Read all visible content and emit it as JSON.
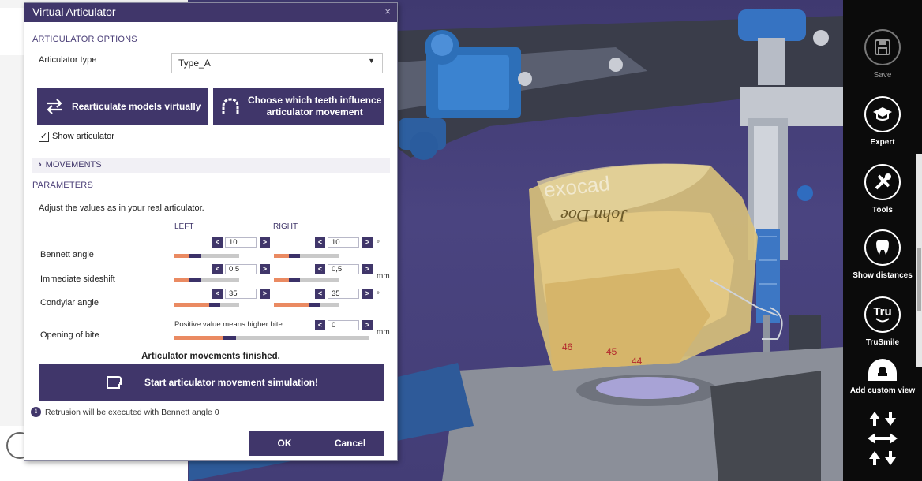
{
  "dialog": {
    "title": "Virtual Articulator",
    "close_glyph": "×",
    "options_heading": "ARTICULATOR OPTIONS",
    "type_label": "Articulator type",
    "type_value": "Type_A",
    "rearticulate_label": "Rearticulate models virtually",
    "teeth_label_line1": "Choose which teeth influence",
    "teeth_label_line2": "articulator movement",
    "show_articulator_label": "Show articulator",
    "show_articulator_checked": true,
    "movements_label": "MOVEMENTS",
    "parameters_heading": "PARAMETERS",
    "parameters_hint": "Adjust the values as in your real articulator.",
    "col_left": "LEFT",
    "col_right": "RIGHT",
    "params": [
      {
        "label": "Bennett angle",
        "left": "10",
        "right": "10",
        "unit": "°",
        "left_level": 0.32,
        "right_level": 0.32
      },
      {
        "label": "Immediate sideshift",
        "left": "0,5",
        "right": "0,5",
        "unit": "mm",
        "left_level": 0.32,
        "right_level": 0.32
      },
      {
        "label": "Condylar angle",
        "left": "35",
        "right": "35",
        "unit": "°",
        "left_level": 0.62,
        "right_level": 0.62
      }
    ],
    "bite": {
      "label": "Opening of bite",
      "note": "Positive value means higher bite",
      "value": "0",
      "unit": "mm",
      "level": 0.31
    },
    "finished_text": "Articulator movements finished.",
    "start_label": "Start articulator movement simulation!",
    "retrusion_note": "Retrusion will be executed with Bennett angle 0",
    "ok_label": "OK",
    "cancel_label": "Cancel"
  },
  "toolbar": {
    "save_label": "Save",
    "expert_label": "Expert",
    "tools_label": "Tools",
    "distances_label": "Show distances",
    "trusmile_label": "TruSmile",
    "trusmile_glyph": "Tru",
    "custom_view_label": "Add custom view"
  },
  "scene": {
    "model_label": "John Doe",
    "model_code": "exocad",
    "tooth_numbers": [
      "46",
      "45",
      "44"
    ]
  },
  "colors": {
    "accent": "#40366a",
    "slider_fill": "#ea8a62",
    "viewport_bg": "#4a4480",
    "toolbar_bg": "#0b0b0b"
  }
}
